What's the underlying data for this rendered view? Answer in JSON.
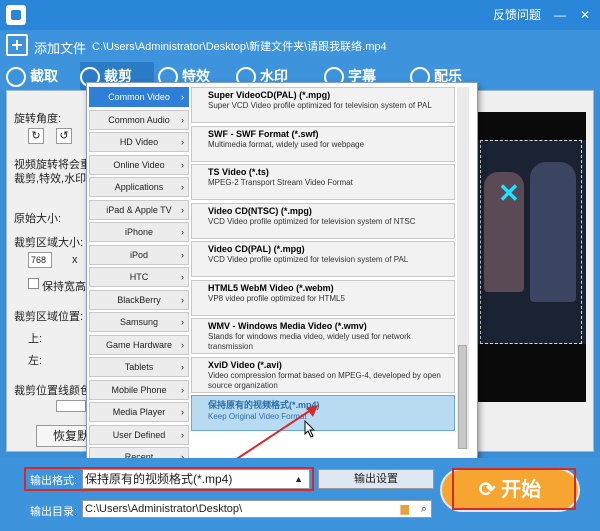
{
  "titlebar": {
    "feedback": "反馈问题",
    "minimize": "—",
    "close": "✕"
  },
  "file": {
    "add_label": "添加文件",
    "path": "C:\\Users\\Administrator\\Desktop\\新建文件夹\\请跟我联络.mp4"
  },
  "tabs": [
    {
      "label": "截取"
    },
    {
      "label": "裁剪"
    },
    {
      "label": "特效"
    },
    {
      "label": "水印"
    },
    {
      "label": "字幕"
    },
    {
      "label": "配乐"
    }
  ],
  "crop_panel": {
    "rotate_label": "旋转角度:",
    "desc_line1": "视频旋转将会重",
    "desc_line2": "裁剪,特效,水印",
    "original_size_label": "原始大小:",
    "crop_size_label": "裁剪区域大小:",
    "width_value": "768",
    "times": "x",
    "keep_ratio_label": "保持宽高",
    "crop_pos_label": "裁剪区域位置:",
    "top_label": "上:",
    "left_label": "左:",
    "crop_color_label": "裁剪位置线颜色",
    "reset_label": "恢复默"
  },
  "popup": {
    "categories": [
      {
        "label": "Common Video",
        "selected": true
      },
      {
        "label": "Common Audio"
      },
      {
        "label": "HD Video"
      },
      {
        "label": "Online Video"
      },
      {
        "label": "Applications"
      },
      {
        "label": "iPad & Apple TV"
      },
      {
        "label": "iPhone"
      },
      {
        "label": "iPod"
      },
      {
        "label": "HTC"
      },
      {
        "label": "BlackBerry"
      },
      {
        "label": "Samsung"
      },
      {
        "label": "Game Hardware"
      },
      {
        "label": "Tablets"
      },
      {
        "label": "Mobile Phone"
      },
      {
        "label": "Media Player"
      },
      {
        "label": "User Defined"
      },
      {
        "label": "Recent"
      }
    ],
    "formats": [
      {
        "title": "Super VideoCD(PAL) (*.mpg)",
        "desc": "Super VCD Video profile optimized for television system of PAL"
      },
      {
        "title": "SWF - SWF Format (*.swf)",
        "desc": "Multimedia format, widely used for webpage"
      },
      {
        "title": "TS Video (*.ts)",
        "desc": "MPEG-2 Transport Stream Video Format"
      },
      {
        "title": "Video CD(NTSC) (*.mpg)",
        "desc": "VCD Video profile optimized for television system of NTSC"
      },
      {
        "title": "Video CD(PAL) (*.mpg)",
        "desc": "VCD Video profile optimized for television system of PAL"
      },
      {
        "title": "HTML5 WebM Video (*.webm)",
        "desc": "VP8 video profile optimized for HTML5"
      },
      {
        "title": "WMV - Windows Media Video (*.wmv)",
        "desc": "Stands for windows media video, widely used for network transmission"
      },
      {
        "title": "XviD Video (*.avi)",
        "desc": "Video compression format based on MPEG-4, developed by open source organization"
      },
      {
        "title": "保持原有的视频格式(*.mp4)",
        "desc": "Keep Original Video Format",
        "selected": true
      }
    ]
  },
  "bottom": {
    "format_label": "输出格式:",
    "format_value": "保持原有的视频格式(*.mp4)",
    "settings_label": "输出设置",
    "dir_label": "输出目录:",
    "dir_value": "C:\\Users\\Administrator\\Desktop\\",
    "start_label": "开始"
  },
  "colors": {
    "accent": "#2a86d8",
    "start": "#f6a531",
    "highlight": "#d62a2a"
  }
}
